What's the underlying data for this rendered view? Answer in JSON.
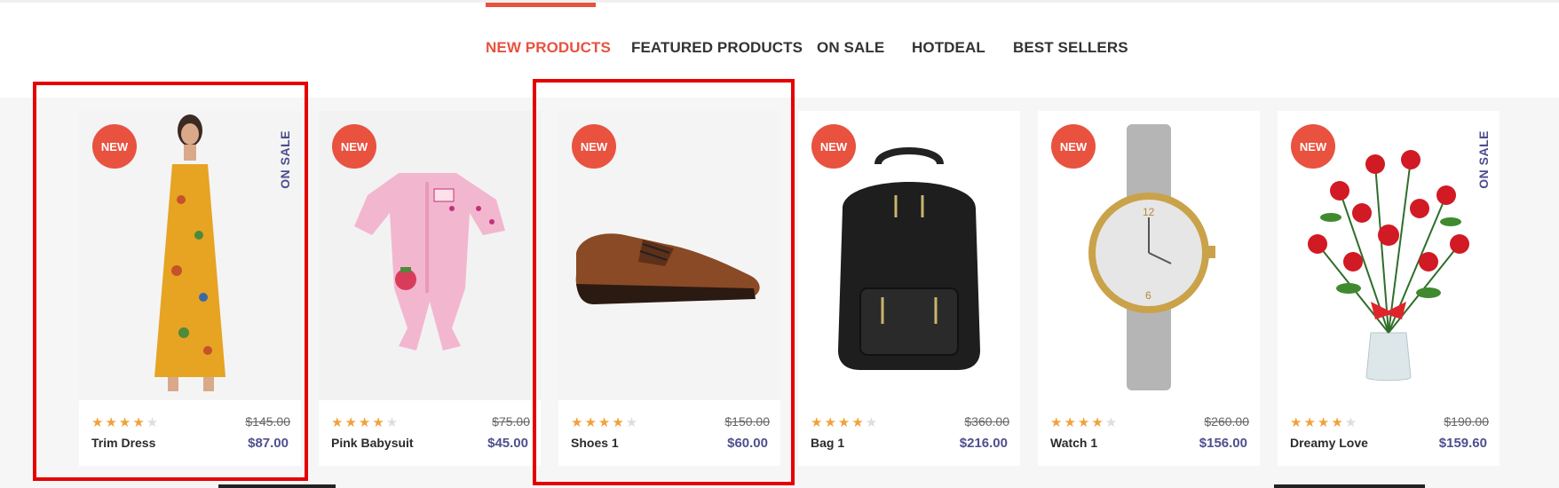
{
  "tabs": [
    {
      "label": "NEW PRODUCTS",
      "active": true
    },
    {
      "label": "FEATURED PRODUCTS",
      "active": false
    },
    {
      "label": "ON SALE",
      "active": false
    },
    {
      "label": "HOTDEAL",
      "active": false
    },
    {
      "label": "BEST SELLERS",
      "active": false
    }
  ],
  "colors": {
    "accent": "#e8523f",
    "price": "#4f4f8f",
    "star": "#f0a23a",
    "highlight": "#e60000"
  },
  "products": [
    {
      "badge": "NEW",
      "onsale": "ON SALE",
      "name": "Trim Dress",
      "old_price": "$145.00",
      "price": "$87.00",
      "rating": 4,
      "icon": "dress-image"
    },
    {
      "badge": "NEW",
      "onsale": "",
      "name": "Pink Babysuit",
      "old_price": "$75.00",
      "price": "$45.00",
      "rating": 4,
      "icon": "babysuit-image"
    },
    {
      "badge": "NEW",
      "onsale": "",
      "name": "Shoes 1",
      "old_price": "$150.00",
      "price": "$60.00",
      "rating": 4,
      "icon": "shoe-image"
    },
    {
      "badge": "NEW",
      "onsale": "",
      "name": "Bag 1",
      "old_price": "$360.00",
      "price": "$216.00",
      "rating": 4,
      "icon": "backpack-image"
    },
    {
      "badge": "NEW",
      "onsale": "",
      "name": "Watch 1",
      "old_price": "$260.00",
      "price": "$156.00",
      "rating": 4,
      "icon": "watch-image"
    },
    {
      "badge": "NEW",
      "onsale": "ON SALE",
      "name": "Dreamy Love",
      "old_price": "$190.00",
      "price": "$159.60",
      "rating": 4,
      "icon": "roses-image"
    }
  ]
}
